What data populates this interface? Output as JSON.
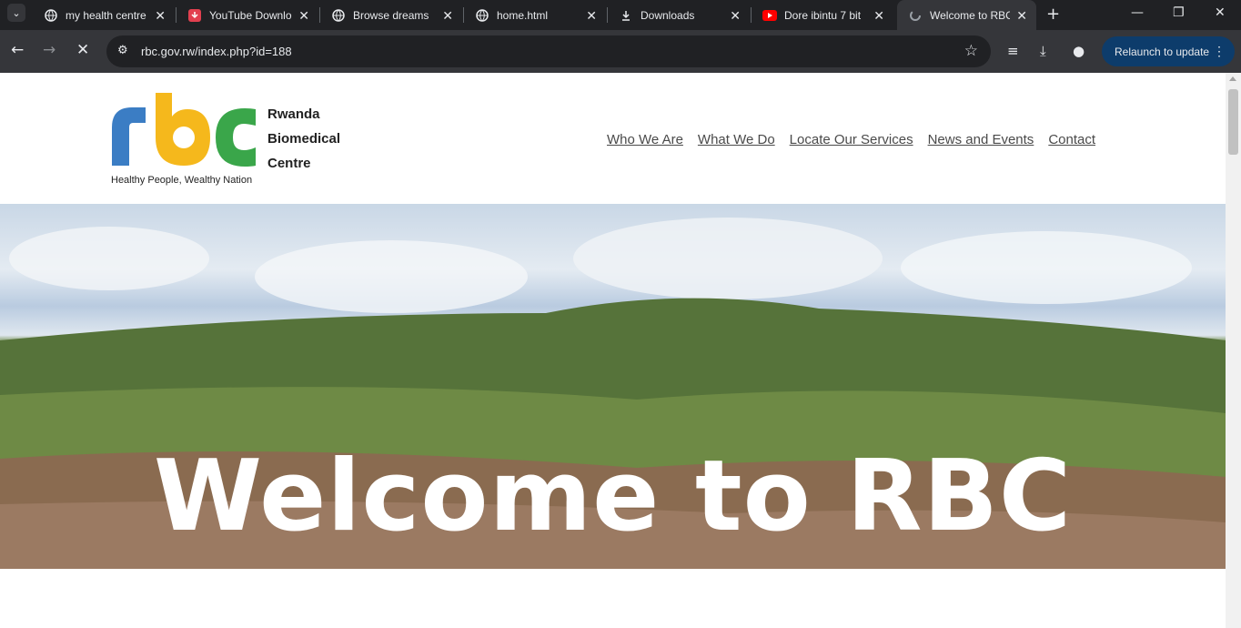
{
  "browser": {
    "tabs": [
      {
        "title": "my health centre",
        "icon": "globe-icon"
      },
      {
        "title": "YouTube Downlo",
        "icon": "download-app-icon"
      },
      {
        "title": "Browse dreams",
        "icon": "globe-icon"
      },
      {
        "title": "home.html",
        "icon": "globe-icon"
      },
      {
        "title": "Downloads",
        "icon": "download-icon"
      },
      {
        "title": "Dore ibintu 7 bit",
        "icon": "youtube-icon"
      },
      {
        "title": "Welcome to RBC",
        "icon": "loading-icon",
        "active": true
      }
    ],
    "url": "rbc.gov.rw/index.php?id=188",
    "relaunch_label": "Relaunch to update"
  },
  "site": {
    "org_line1": "Rwanda",
    "org_line2": "Biomedical",
    "org_line3": "Centre",
    "tagline": "Healthy People, Wealthy Nation",
    "nav": [
      "Who We Are",
      "What We Do",
      "Locate Our Services",
      "News and Events",
      "Contact"
    ],
    "hero_title": "Welcome to RBC"
  },
  "colors": {
    "logo_blue": "#3b7dc4",
    "logo_yellow": "#f5b81c",
    "logo_green": "#3aa64a"
  }
}
